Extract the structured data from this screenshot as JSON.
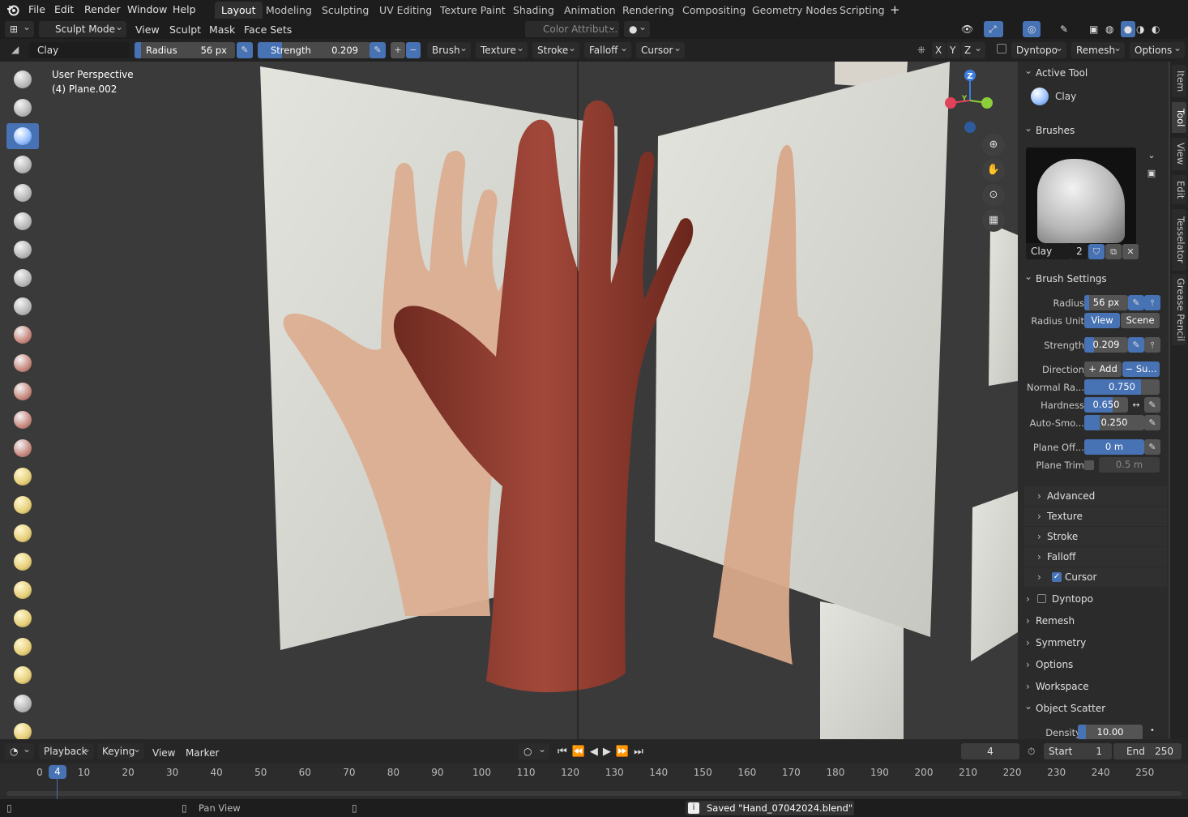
{
  "menubar": {
    "items": [
      "File",
      "Edit",
      "Render",
      "Window",
      "Help"
    ],
    "workspaces": [
      "Layout",
      "Modeling",
      "Sculpting",
      "UV Editing",
      "Texture Paint",
      "Shading",
      "Animation",
      "Rendering",
      "Compositing",
      "Geometry Nodes",
      "Scripting"
    ],
    "active_workspace": "Layout"
  },
  "header": {
    "mode": "Sculpt Mode",
    "menus": [
      "View",
      "Sculpt",
      "Mask",
      "Face Sets"
    ],
    "color_attr": "Color Attribut...",
    "axes": [
      "X",
      "Y",
      "Z"
    ],
    "dyntopo": "Dyntopo",
    "remesh": "Remesh",
    "options": "Options"
  },
  "toolsettings": {
    "brush_name": "Clay",
    "radius_label": "Radius",
    "radius_value": "56 px",
    "strength_label": "Strength",
    "strength_value": "0.209",
    "menus": [
      "Brush",
      "Texture",
      "Stroke",
      "Falloff",
      "Cursor"
    ]
  },
  "viewport": {
    "perspective": "User Perspective",
    "object": "(4) Plane.002",
    "gizmo": {
      "z": "Z",
      "y": "Y",
      "x": "X"
    }
  },
  "sidebar": {
    "tabs": [
      "Item",
      "Tool",
      "View",
      "Edit",
      "Tesselator",
      "Grease Pencil"
    ],
    "active_tab": "Tool",
    "active_tool": {
      "header": "Active Tool",
      "name": "Clay"
    },
    "brushes": {
      "header": "Brushes",
      "name": "Clay",
      "users": "2"
    },
    "brush_settings": {
      "header": "Brush Settings",
      "radius_label": "Radius",
      "radius_value": "56 px",
      "radius_unit_label": "Radius Unit",
      "radius_unit_view": "View",
      "radius_unit_scene": "Scene",
      "strength_label": "Strength",
      "strength_value": "0.209",
      "direction_label": "Direction",
      "direction_add": "Add",
      "direction_sub": "Su...",
      "normal_label": "Normal Ra...",
      "normal_value": "0.750",
      "normal_fraction": 0.75,
      "hardness_label": "Hardness",
      "hardness_value": "0.650",
      "hardness_fraction": 0.65,
      "autosmooth_label": "Auto-Smo...",
      "autosmooth_value": "0.250",
      "autosmooth_fraction": 0.25,
      "planeoff_label": "Plane Off...",
      "planeoff_value": "0 m",
      "planetrim_label": "Plane Trim",
      "planetrim_value": "0.5 m"
    },
    "subpanels": [
      "Advanced",
      "Texture",
      "Stroke",
      "Falloff",
      "Cursor"
    ],
    "panels": [
      "Dyntopo",
      "Remesh",
      "Symmetry",
      "Options",
      "Workspace"
    ],
    "object_scatter": {
      "header": "Object Scatter",
      "density_label": "Density",
      "density_value": "10.00"
    }
  },
  "timeline": {
    "menus": [
      "Playback",
      "Keying",
      "View",
      "Marker"
    ],
    "current_frame": "4",
    "start_label": "Start",
    "start_value": "1",
    "end_label": "End",
    "end_value": "250",
    "ticks": [
      "0",
      "10",
      "20",
      "30",
      "40",
      "50",
      "60",
      "70",
      "80",
      "90",
      "100",
      "110",
      "120",
      "130",
      "140",
      "150",
      "160",
      "170",
      "180",
      "190",
      "200",
      "210",
      "220",
      "230",
      "240",
      "250"
    ],
    "playhead": "4"
  },
  "status": {
    "pan": "Pan View",
    "message": "Saved \"Hand_07042024.blend\""
  },
  "colors": {
    "accent": "#4772b3",
    "clay": "#8a3a2c",
    "photo_bg": "#dcdcd6",
    "skin": "#d9a98a"
  }
}
